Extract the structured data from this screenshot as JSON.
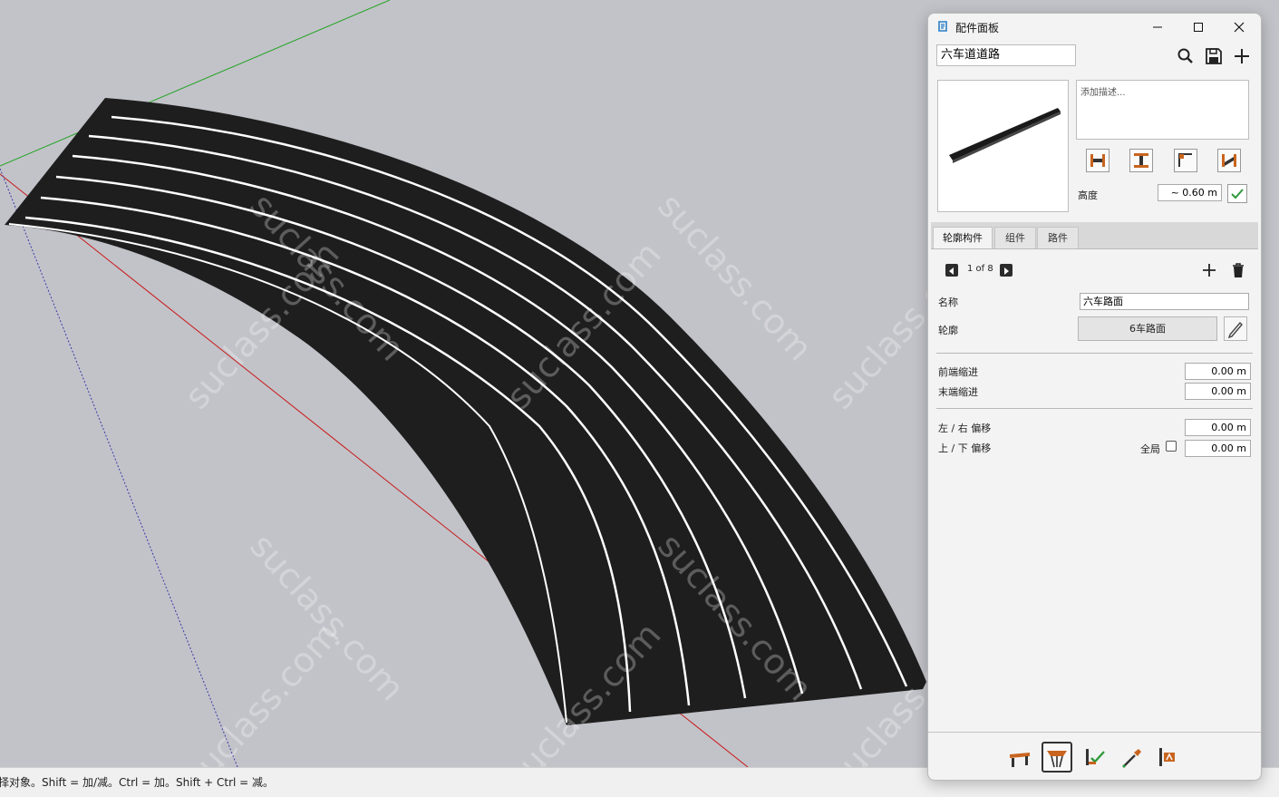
{
  "statusbar": {
    "hint": "择对象。Shift = 加/减。Ctrl = 加。Shift + Ctrl = 减。"
  },
  "watermark": "suclass.com",
  "panel": {
    "title": "配件面板",
    "icons": {
      "app": "sketchup-icon",
      "minimize": "minimize-icon",
      "maximize": "maximize-icon",
      "close": "close-icon"
    },
    "name_value": "六车道道路",
    "toolbar_icons": [
      "search-icon",
      "save-icon",
      "add-icon"
    ],
    "description_placeholder": "添加描述...",
    "height": {
      "label": "高度",
      "value": "~ 0.60 m"
    },
    "tabs": [
      {
        "label": "轮廓构件",
        "active": true
      },
      {
        "label": "组件",
        "active": false
      },
      {
        "label": "路件",
        "active": false
      }
    ],
    "pager": {
      "text": "1 of 8"
    },
    "fields": {
      "name": {
        "label": "名称",
        "value": "六车路面"
      },
      "profile": {
        "label": "轮廓",
        "value": "6车路面"
      },
      "start_inset": {
        "label": "前端缩进",
        "value": "0.00 m"
      },
      "end_inset": {
        "label": "末端缩进",
        "value": "0.00 m"
      },
      "lr_offset": {
        "label": "左 / 右 偏移",
        "value": "0.00 m"
      },
      "ud_offset": {
        "label": "上 / 下 偏移",
        "value": "0.00 m"
      },
      "global": {
        "label": "全局",
        "checked": false
      }
    },
    "bottom_tools": [
      "path-tool-icon",
      "profile-tool-icon",
      "apply-tool-icon",
      "eyedropper-icon",
      "attribute-tool-icon"
    ]
  },
  "colors": {
    "accent": "#2a7fc7",
    "road": "#1e1e1e",
    "lane_line": "#ffffff",
    "axis_red": "#c81a1a",
    "axis_green": "#26a326",
    "axis_blue": "#3a3aa8"
  }
}
